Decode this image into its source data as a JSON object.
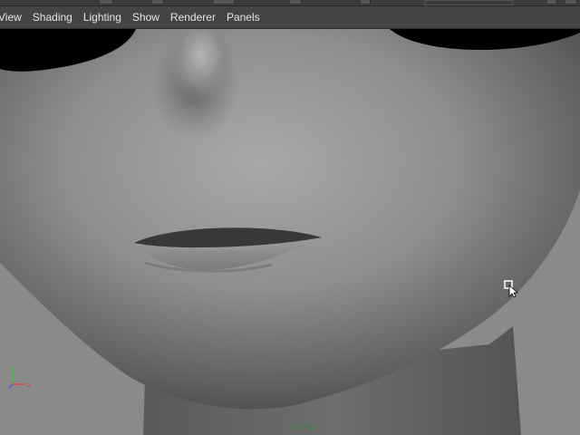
{
  "menubar": {
    "items": [
      {
        "label": "View"
      },
      {
        "label": "Shading"
      },
      {
        "label": "Lighting"
      },
      {
        "label": "Show"
      },
      {
        "label": "Renderer"
      },
      {
        "label": "Panels"
      }
    ]
  },
  "viewport": {
    "camera_label": "persp",
    "axis": {
      "x_label": "x",
      "y_label": "y",
      "z_label": "z"
    }
  },
  "colors": {
    "menubar_bg": "#444444",
    "viewport_bg": "#8a8a8a",
    "camera_label": "#2e8b3e",
    "axis_x": "#e04040",
    "axis_y": "#40c040",
    "axis_z": "#4060ff"
  },
  "icons": [
    "cursor-icon",
    "axis-gizmo-icon"
  ]
}
